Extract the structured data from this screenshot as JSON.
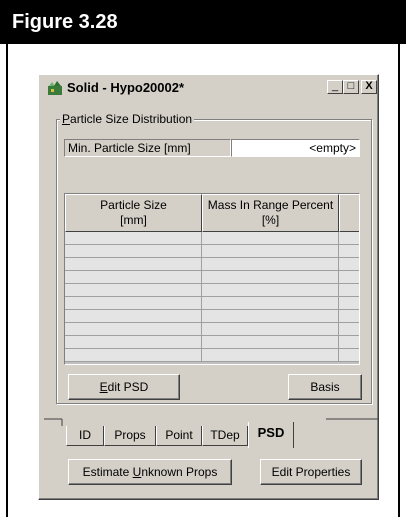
{
  "figure": {
    "label": "Figure 3.28"
  },
  "window": {
    "title": "Solid - Hypo20002*",
    "controls": {
      "minimize": "_",
      "maximize": "□",
      "close": "X"
    }
  },
  "psd_group": {
    "label_prefix": "",
    "label_underline": "P",
    "label_rest": "article Size Distribution",
    "min_particle_label": "Min. Particle Size [mm]",
    "min_particle_value": "<empty>"
  },
  "table": {
    "columns": [
      {
        "line1": "Particle Size",
        "line2": "[mm]"
      },
      {
        "line1": "Mass In Range Percent",
        "line2": "[%]"
      }
    ],
    "empty_rows": 10
  },
  "buttons": {
    "edit_psd_underline": "E",
    "edit_psd_rest": "dit PSD",
    "basis": "Basis",
    "estimate_prefix": "Estimate ",
    "estimate_underline": "U",
    "estimate_rest": "nknown Props",
    "edit_properties": "Edit Properties"
  },
  "tabs": [
    "ID",
    "Props",
    "Point",
    "TDep",
    "PSD"
  ],
  "active_tab": "PSD"
}
